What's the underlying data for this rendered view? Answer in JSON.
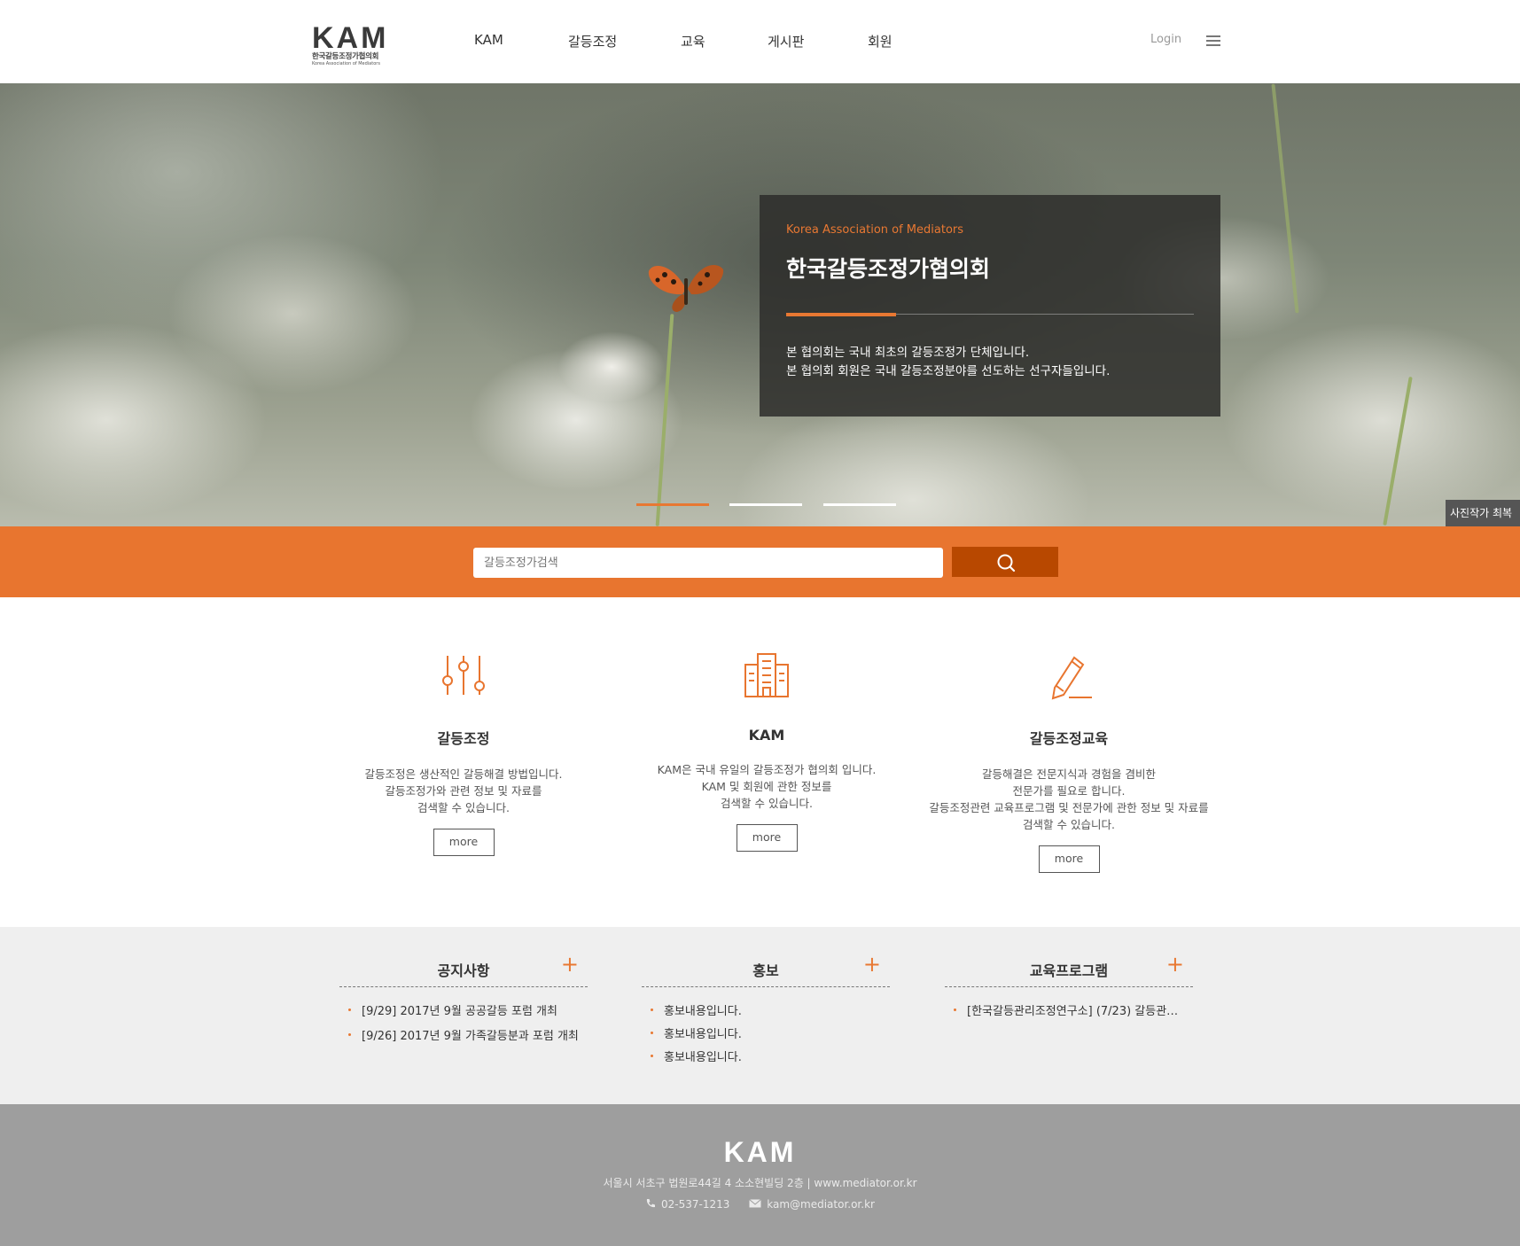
{
  "header": {
    "logo": {
      "main": "KAM",
      "korean": "한국갈등조정가협의회",
      "english": "Korea Association of Mediators"
    },
    "nav": [
      "KAM",
      "갈등조정",
      "교육",
      "게시판",
      "회원"
    ],
    "login": "Login",
    "menu_icon": "hamburger-icon"
  },
  "hero": {
    "subtitle": "Korea Association of Mediators",
    "title": "한국갈등조정가협의회",
    "desc_line1": "본 협의회는 국내 최초의 갈등조정가 단체입니다.",
    "desc_line2": "본 협의회 회원은 국내 갈등조정분야를 선도하는 선구자들입니다.",
    "slides_total": 3,
    "slide_active": 1,
    "photo_credit": "사진작가 최복"
  },
  "search": {
    "placeholder": "갈등조정가검색",
    "button_icon": "search-icon"
  },
  "features": [
    {
      "icon": "sliders-icon",
      "title": "갈등조정",
      "desc": [
        "갈등조정은 생산적인 갈등해결 방법입니다.",
        "갈등조정가와 관련 정보 및 자료를",
        "검색할 수 있습니다."
      ],
      "more": "more"
    },
    {
      "icon": "building-icon",
      "title": "KAM",
      "desc": [
        "KAM은 국내 유일의 갈등조정가 협의회 입니다.",
        "KAM 및 회원에 관한 정보를",
        "검색할 수 있습니다."
      ],
      "more": "more"
    },
    {
      "icon": "pencil-icon",
      "title": "갈등조정교육",
      "desc": [
        "갈등해결은 전문지식과 경험을 겸비한",
        "전문가를 필요로 합니다.",
        "갈등조정관련 교육프로그램 및 전문가에 관한 정보 및 자료를",
        "검색할 수 있습니다."
      ],
      "more": "more"
    }
  ],
  "boards": [
    {
      "title": "공지사항",
      "plus": "+",
      "items": [
        "[9/29] 2017년 9월 공공갈등 포럼 개최",
        "[9/26] 2017년 9월 가족갈등분과 포럼 개최"
      ]
    },
    {
      "title": "홍보",
      "plus": "+",
      "items": [
        "홍보내용입니다.",
        "홍보내용입니다.",
        "홍보내용입니다."
      ]
    },
    {
      "title": "교육프로그램",
      "plus": "+",
      "items": [
        "[한국갈등관리조정연구소] (7/23) 갈등관…"
      ]
    }
  ],
  "footer": {
    "logo": "KAM",
    "address": "서울시 서초구 법원로44길 4 소소현빌딩 2층 | www.mediator.or.kr",
    "phone": "02-537-1213",
    "email": "kam@mediator.or.kr"
  },
  "colors": {
    "accent": "#e8752f",
    "search_button": "#b84800",
    "footer": "#9e9e9e",
    "boards_bg": "#efefef"
  }
}
